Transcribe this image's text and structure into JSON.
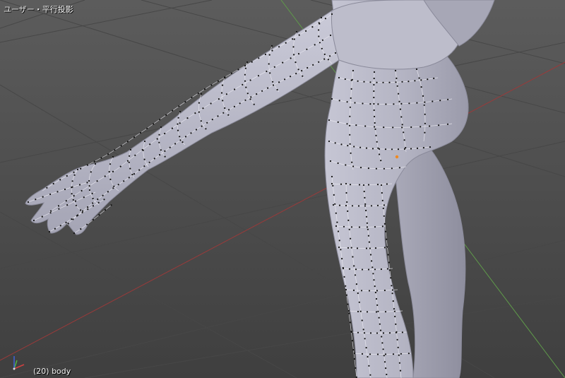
{
  "viewport": {
    "view_label": "ユーザー・平行投影",
    "object_label": "(20) body"
  },
  "colors": {
    "background_top": "#5c5c5c",
    "background_bottom": "#3f3f3f",
    "grid_line": "#454545",
    "x_axis": "#9a3a3a",
    "y_axis": "#5f9a4a",
    "mesh_fill": "#b8b8c8",
    "wire": "#e8e8ee",
    "vertex": "#111111",
    "selected_vertex": "#f08a20"
  },
  "icons": {
    "axis_gizmo": "axis-gizmo-icon"
  }
}
